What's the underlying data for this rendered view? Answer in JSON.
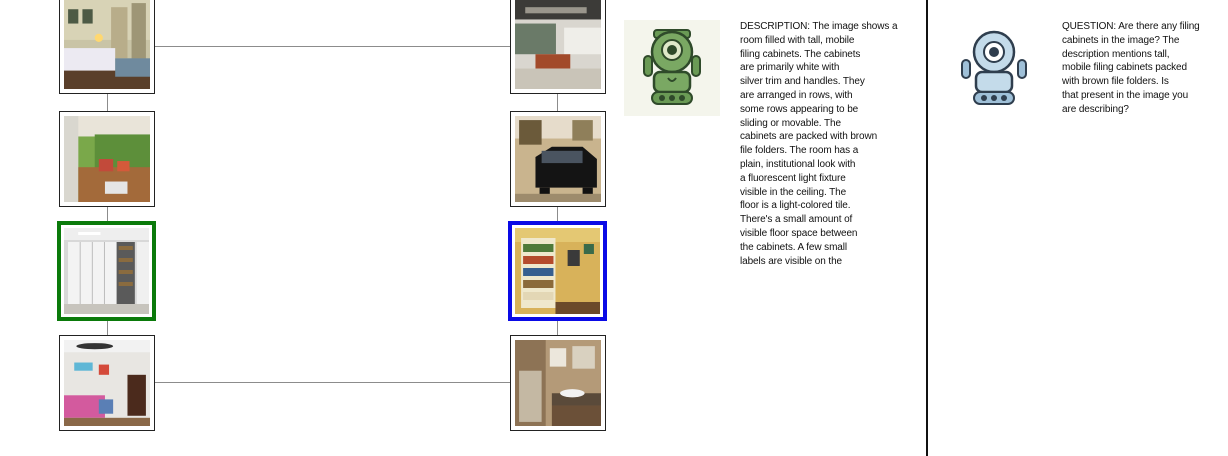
{
  "graph": {
    "left_column": [
      {
        "name": "bedroom-hallway-photo",
        "selected": null
      },
      {
        "name": "patio-deck-photo",
        "selected": null
      },
      {
        "name": "filing-cabinet-room-photo",
        "selected": "green"
      },
      {
        "name": "kids-bedroom-photo",
        "selected": null
      }
    ],
    "right_column": [
      {
        "name": "office-lobby-photo",
        "selected": null
      },
      {
        "name": "garage-car-photo",
        "selected": null
      },
      {
        "name": "bookshelf-room-photo",
        "selected": "blue"
      },
      {
        "name": "bathroom-photo",
        "selected": null
      }
    ],
    "colors": {
      "selected_left": "#0a7a0a",
      "selected_right": "#0a0ae6",
      "connector": "#8c8c8c"
    }
  },
  "describer": {
    "avatar_icon": "green-robot-icon",
    "lines": [
      "DESCRIPTION: The image shows a",
      "room filled with tall, mobile",
      "filing cabinets. The cabinets",
      "are primarily white with",
      "silver trim and handles. They",
      "are arranged in rows, with",
      "some rows appearing to be",
      "sliding or movable. The",
      "cabinets are packed with brown",
      "file folders. The room has a",
      "plain, institutional look with",
      "a fluorescent light fixture",
      "visible in the ceiling. The",
      "floor is a light-colored tile.",
      "There's a small amount of",
      "visible floor space between",
      "the cabinets. A few small",
      "labels are visible on the"
    ]
  },
  "questioner": {
    "avatar_icon": "blue-robot-icon",
    "lines": [
      "QUESTION: Are there any filing",
      "cabinets in the image? The",
      "description mentions tall,",
      "mobile filing cabinets packed",
      "with brown file folders. Is",
      "that present in the image you",
      "are describing?"
    ]
  }
}
